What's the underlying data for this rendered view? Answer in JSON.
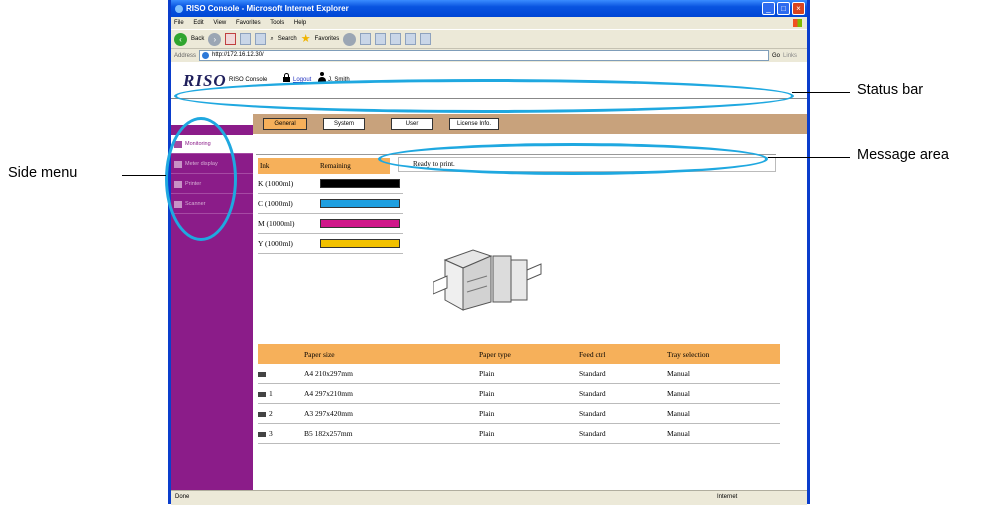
{
  "window": {
    "title": "RISO Console - Microsoft Internet Explorer",
    "menus": [
      "File",
      "Edit",
      "View",
      "Favorites",
      "Tools",
      "Help"
    ],
    "toolbar": {
      "back": "Back",
      "search": "Search",
      "favorites": "Favorites"
    },
    "address_label": "Address",
    "address_value": "http://172.16.12.30/",
    "go_label": "Go",
    "links_label": "Links"
  },
  "app": {
    "logo": "RISO",
    "console_label": "RISO Console",
    "logout_label": "Logout",
    "user_name": "J. Smith",
    "tabs": [
      {
        "label": "General",
        "active": true
      },
      {
        "label": "System"
      },
      {
        "label": "User"
      },
      {
        "label": "License Info."
      }
    ],
    "sidebar": [
      {
        "label": "Monitoring",
        "active": true
      },
      {
        "label": "Meter display"
      },
      {
        "label": "Printer"
      },
      {
        "label": "Scanner"
      }
    ],
    "message": "Ready to print.",
    "ink_header": {
      "ink": "Ink",
      "remaining": "Remaining"
    },
    "inks": [
      {
        "label": "K (1000ml)",
        "color": "#000000"
      },
      {
        "label": "C (1000ml)",
        "color": "#1E9FE0"
      },
      {
        "label": "M (1000ml)",
        "color": "#D0178A"
      },
      {
        "label": "Y (1000ml)",
        "color": "#F2C100"
      }
    ],
    "paper_headers": [
      "Paper size",
      "Paper type",
      "Feed ctrl",
      "Tray selection"
    ],
    "paper_rows": [
      {
        "tray": "",
        "size": "A4 210x297mm",
        "type": "Plain",
        "feed": "Standard",
        "sel": "Manual"
      },
      {
        "tray": "1",
        "size": "A4 297x210mm",
        "type": "Plain",
        "feed": "Standard",
        "sel": "Manual"
      },
      {
        "tray": "2",
        "size": "A3 297x420mm",
        "type": "Plain",
        "feed": "Standard",
        "sel": "Manual"
      },
      {
        "tray": "3",
        "size": "B5 182x257mm",
        "type": "Plain",
        "feed": "Standard",
        "sel": "Manual"
      }
    ]
  },
  "status": {
    "left": "Done",
    "zone": "Internet"
  },
  "callouts": {
    "status_bar": "Status bar",
    "side_menu": "Side menu",
    "message_area": "Message area"
  },
  "colors": {
    "callout_ring": "#1FA8E0",
    "sidebar": "#8B1C89",
    "accent": "#F6B05A"
  }
}
